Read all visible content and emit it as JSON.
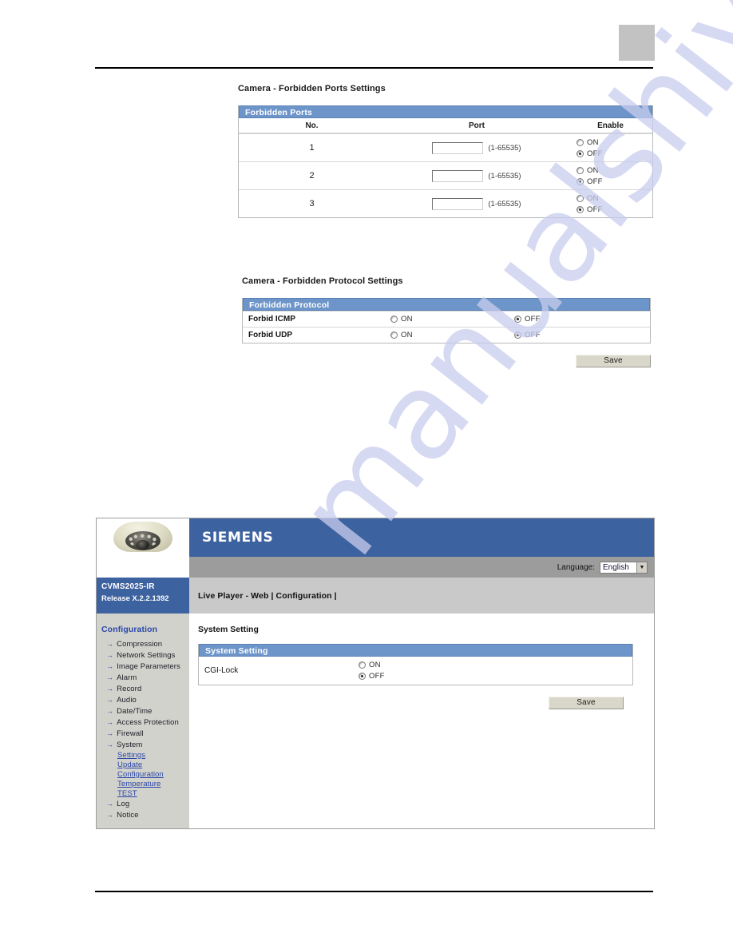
{
  "document": {
    "page_marker": ""
  },
  "ports_section": {
    "caption": "Camera - Forbidden Ports Settings",
    "table_title": "Forbidden Ports",
    "columns": [
      "No.",
      "Port",
      "Enable"
    ],
    "port_hint": "(1-65535)",
    "radio_on_label": "ON",
    "radio_off_label": "OFF",
    "rows": [
      {
        "no": "1",
        "port_value": "",
        "enable": "OFF"
      },
      {
        "no": "2",
        "port_value": "",
        "enable": "OFF"
      },
      {
        "no": "3",
        "port_value": "",
        "enable": "OFF"
      }
    ]
  },
  "protocol_section": {
    "caption": "Camera - Forbidden Protocol Settings",
    "table_title": "Forbidden Protocol",
    "radio_on_label": "ON",
    "radio_off_label": "OFF",
    "rows": [
      {
        "name": "Forbid ICMP",
        "value": "OFF"
      },
      {
        "name": "Forbid UDP",
        "value": "OFF"
      }
    ],
    "save_label": "Save"
  },
  "browser": {
    "brand": "SIEMENS",
    "language_label": "Language:",
    "language_value": "English",
    "language_arrow": "▼",
    "model_name": "CVMS2025-IR",
    "model_release": "Release X.2.2.1392",
    "nav_text": "Live Player - Web  | Configuration  |",
    "sidebar": {
      "title": "Configuration",
      "arrow_glyph": "→",
      "items": [
        {
          "label": "Compression",
          "type": "link"
        },
        {
          "label": "Network Settings",
          "type": "link"
        },
        {
          "label": "Image Parameters",
          "type": "link"
        },
        {
          "label": "Alarm",
          "type": "link"
        },
        {
          "label": "Record",
          "type": "link"
        },
        {
          "label": "Audio",
          "type": "link"
        },
        {
          "label": "Date/Time",
          "type": "link"
        },
        {
          "label": "Access Protection",
          "type": "link"
        },
        {
          "label": "Firewall",
          "type": "link"
        },
        {
          "label": "System",
          "type": "link"
        }
      ],
      "sub_items": [
        {
          "label": "Settings"
        },
        {
          "label": "Update"
        },
        {
          "label": "Configuration"
        },
        {
          "label": "Temperature"
        },
        {
          "label": "TEST"
        }
      ],
      "tail_items": [
        {
          "label": "Log",
          "type": "link"
        },
        {
          "label": "Notice",
          "type": "link"
        }
      ]
    },
    "content": {
      "page_title": "System Setting",
      "table_title": "System Setting",
      "setting_name": "CGI-Lock",
      "radio_on_label": "ON",
      "radio_off_label": "OFF",
      "setting_value": "OFF",
      "save_label": "Save"
    }
  },
  "watermark": {
    "text": "manualshive.com"
  },
  "colors": {
    "brand_blue": "#3d62a0",
    "table_header_blue": "#6d95c9",
    "sidebar_gray": "#d2d2cc",
    "navbar_gray": "#c9c9c9",
    "langbar_gray": "#9c9c9c",
    "button_face": "#d9d7ca",
    "link_blue": "#2a47a8",
    "watermark": "#c9cdee"
  }
}
